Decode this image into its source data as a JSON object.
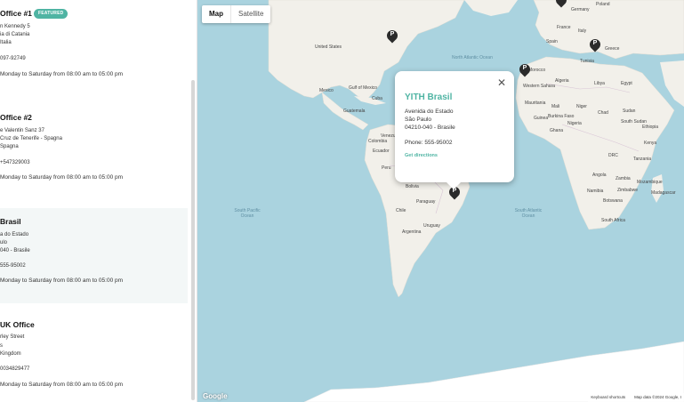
{
  "stores": [
    {
      "title": "Office #1",
      "badge": "FEATURED",
      "address": [
        "n Kennedy 5",
        "ia di Catania",
        "Italia"
      ],
      "phone": "097-92749",
      "hours": "Monday to Saturday from 08:00 am to 05:00 pm"
    },
    {
      "title": "Office #2",
      "address": [
        "e Valentin Sanz 37",
        "Cruz de Tenerife - Spagna",
        "Spagna"
      ],
      "phone": "+547329003",
      "hours": "Monday to Saturday from 08:00 am to 05:00 pm"
    },
    {
      "title": "Brasil",
      "address": [
        "a do Estado",
        "ulo",
        "040 - Brasile"
      ],
      "phone": "555-95002",
      "hours": "Monday to Saturday from 08:00 am to 05:00 pm"
    },
    {
      "title": "UK Office",
      "address": [
        "rley Street",
        "s",
        "Kingdom"
      ],
      "phone": "0034829477",
      "hours": "Monday to Saturday from 08:00 am to 05:00 pm"
    }
  ],
  "map": {
    "tab_map": "Map",
    "tab_satellite": "Satellite",
    "google_logo": "Google",
    "keyboard_shortcuts": "Keyboard shortcuts",
    "map_data": "Map data ©2024 Google, I",
    "colors": {
      "water": "#aad3df",
      "land": "#f2f0ea",
      "accent": "#4fb4a3"
    },
    "labels": {
      "united_states": "United States",
      "mexico": "Mexico",
      "venezuela": "Venezuela",
      "colombia": "Colombia",
      "ecuador": "Ecuador",
      "peru": "Peru",
      "bolivia": "Bolivia",
      "paraguay": "Paraguay",
      "chile": "Chile",
      "argentina": "Argentina",
      "uruguay": "Uruguay",
      "guatemala": "Guatemala",
      "cuba": "Cuba",
      "morocco": "Morocco",
      "algeria": "Algeria",
      "libya": "Libya",
      "egypt": "Egypt",
      "mali": "Mali",
      "niger": "Niger",
      "chad": "Chad",
      "sudan": "Sudan",
      "nigeria": "Nigeria",
      "ethiopia": "Ethiopia",
      "kenya": "Kenya",
      "drc": "DRC",
      "tanzania": "Tanzania",
      "angola": "Angola",
      "zambia": "Zambia",
      "namibia": "Namibia",
      "botswana": "Botswana",
      "zimbabwe": "Zimbabwe",
      "mozambique": "Mozambique",
      "madagascar": "Madagascar",
      "south_africa": "South Africa",
      "spain": "Spain",
      "france": "France",
      "germany": "Germany",
      "poland": "Poland",
      "italy": "Italy",
      "tunisia": "Tunisia",
      "greece": "Greece",
      "western_sahara": "Western Sahara",
      "mauritania": "Mauritania",
      "burkina_faso": "Burkina Faso",
      "ghana": "Ghana",
      "sudan_s": "South Sudan",
      "guinea": "Guinea",
      "north_atlantic_ocean": "North Atlantic Ocean",
      "south_pacific_ocean": "South Pacific Ocean",
      "south_atlantic_ocean": "South Atlantic Ocean",
      "gulf_of_mexico": "Gulf of Mexico"
    }
  },
  "info_window": {
    "title": "YITH Brasil",
    "address_line1": "Avenida do Estado",
    "address_line2": "São Paulo",
    "address_line3": "04210-040 - Brasile",
    "phone": "Phone: 555-95002",
    "directions": "Get directions"
  }
}
